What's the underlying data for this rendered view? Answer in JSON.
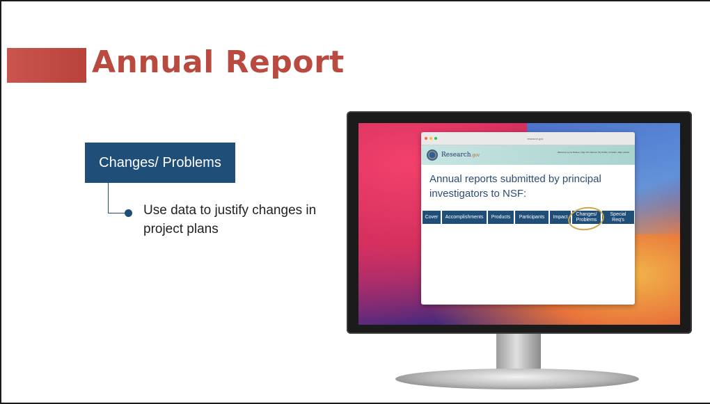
{
  "slide": {
    "title": "Annual Report",
    "callout_label": "Changes/ Problems",
    "bullet": "Use data to justify changes in project plans"
  },
  "browser": {
    "url": "research.gov",
    "site_name": "Research",
    "site_name_suffix": ".gov",
    "header_links": "Welcome Lynne Raidee | Sign Out Jahnner  My Profile | Contact | Help | About",
    "heading": "Annual reports submitted by principal investigators to NSF:",
    "tabs": [
      "Cover",
      "Accomplishments",
      "Products",
      "Participants",
      "Impact",
      "Changes/ Problems",
      "Special Req's"
    ],
    "highlighted_tab_index": 5
  },
  "colors": {
    "title": "#b84a40",
    "accent_bar": "#c9554e",
    "navy": "#1f4e79",
    "highlight_circle": "#c9a84a"
  }
}
